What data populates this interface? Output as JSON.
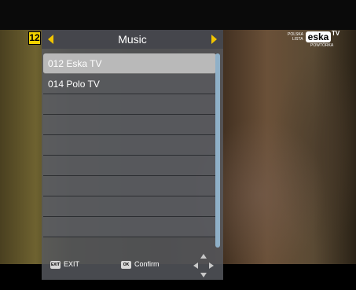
{
  "overlay": {
    "channel_number": "12",
    "logo": {
      "line1": "POLSKA",
      "line2": "LISTA",
      "word": "eska",
      "suffix": "TV",
      "sub": "POWTÓRKA"
    }
  },
  "panel": {
    "title": "Music",
    "channels": [
      {
        "label": "012 Eska TV",
        "selected": true
      },
      {
        "label": "014 Polo TV",
        "selected": false
      },
      {
        "label": "",
        "selected": false
      },
      {
        "label": "",
        "selected": false
      },
      {
        "label": "",
        "selected": false
      },
      {
        "label": "",
        "selected": false
      },
      {
        "label": "",
        "selected": false
      },
      {
        "label": "",
        "selected": false
      },
      {
        "label": "",
        "selected": false
      },
      {
        "label": "",
        "selected": false
      }
    ],
    "footer": {
      "exit_key": "EXIT",
      "exit_label": "EXIT",
      "ok_key": "OK",
      "ok_label": "Confirm"
    }
  },
  "colors": {
    "accent": "#f0c400",
    "selected_row": "#b9b9b9",
    "scrollbar": "#8fb0c8"
  },
  "icons": [
    "left-arrow-icon",
    "right-arrow-icon",
    "dpad-icon"
  ]
}
